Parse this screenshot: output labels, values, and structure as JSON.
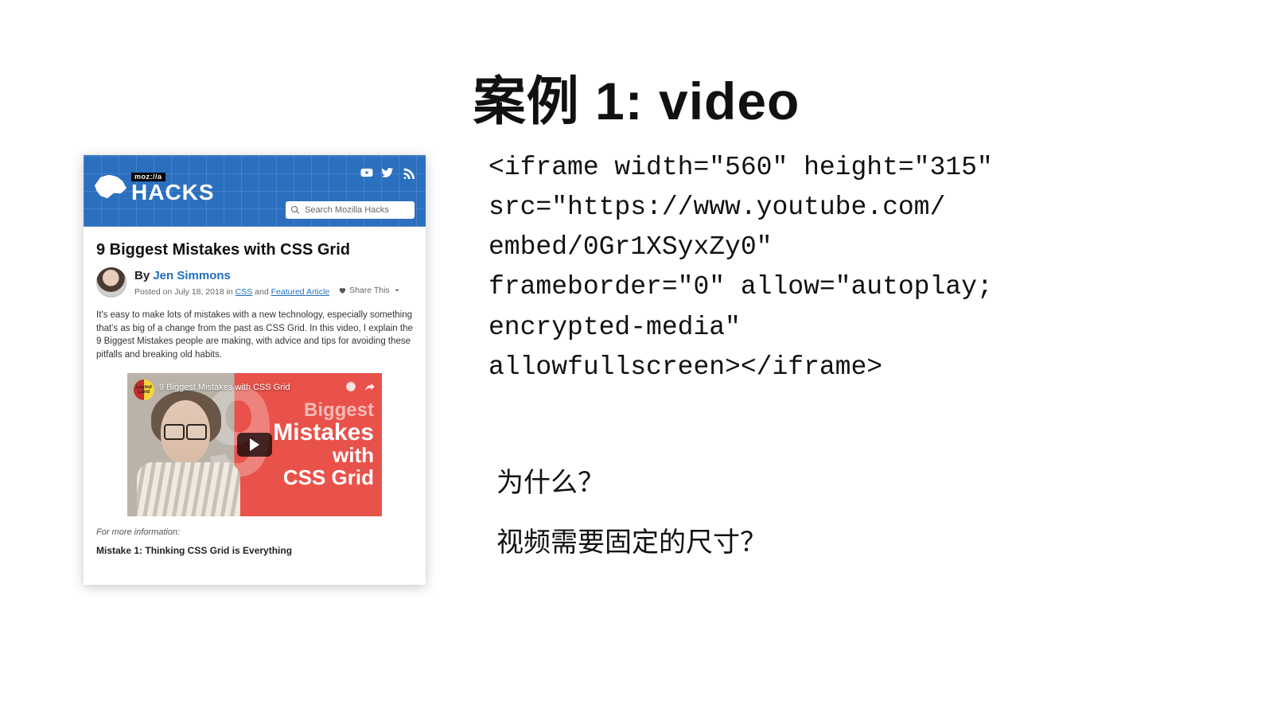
{
  "slide": {
    "title": "案例 1: video"
  },
  "hacks": {
    "moz_label": "moz://a",
    "brand": "HACKS",
    "search_placeholder": "Search Mozilla Hacks",
    "article_title": "9 Biggest Mistakes with CSS Grid",
    "by_label": "By ",
    "author": "Jen Simmons",
    "meta_prefix": "Posted on July 18, 2018 in ",
    "meta_cat1": "CSS",
    "meta_and": " and ",
    "meta_cat2": "Featured Article",
    "share_label": "Share This",
    "intro": "It's easy to make lots of mistakes with a new technology, especially something that's as big of a change from the past as CSS Grid. In this video, I explain the 9 Biggest Mistakes people are making, with advice and tips for avoiding these pitfalls and breaking old habits.",
    "video_chip": "Layout Land",
    "video_caption": "9 Biggest Mistakes with CSS Grid",
    "video_overlay_l1": "Biggest",
    "video_overlay_l2": "Mistakes",
    "video_overlay_l3": "with",
    "video_overlay_l4": "CSS Grid",
    "more_info": "For more information:",
    "mistake1": "Mistake 1: Thinking CSS Grid is Everything"
  },
  "code": {
    "l1": "<iframe width=\"560\" height=\"315\"",
    "l2": "src=\"https://www.youtube.com/",
    "l3": "embed/0Gr1XSyxZy0\"",
    "l4": "frameborder=\"0\" allow=\"autoplay;",
    "l5": "encrypted-media\"",
    "l6": "allowfullscreen></iframe>"
  },
  "qa": {
    "q1": "为什么？",
    "q2": "视频需要固定的尺寸？"
  }
}
